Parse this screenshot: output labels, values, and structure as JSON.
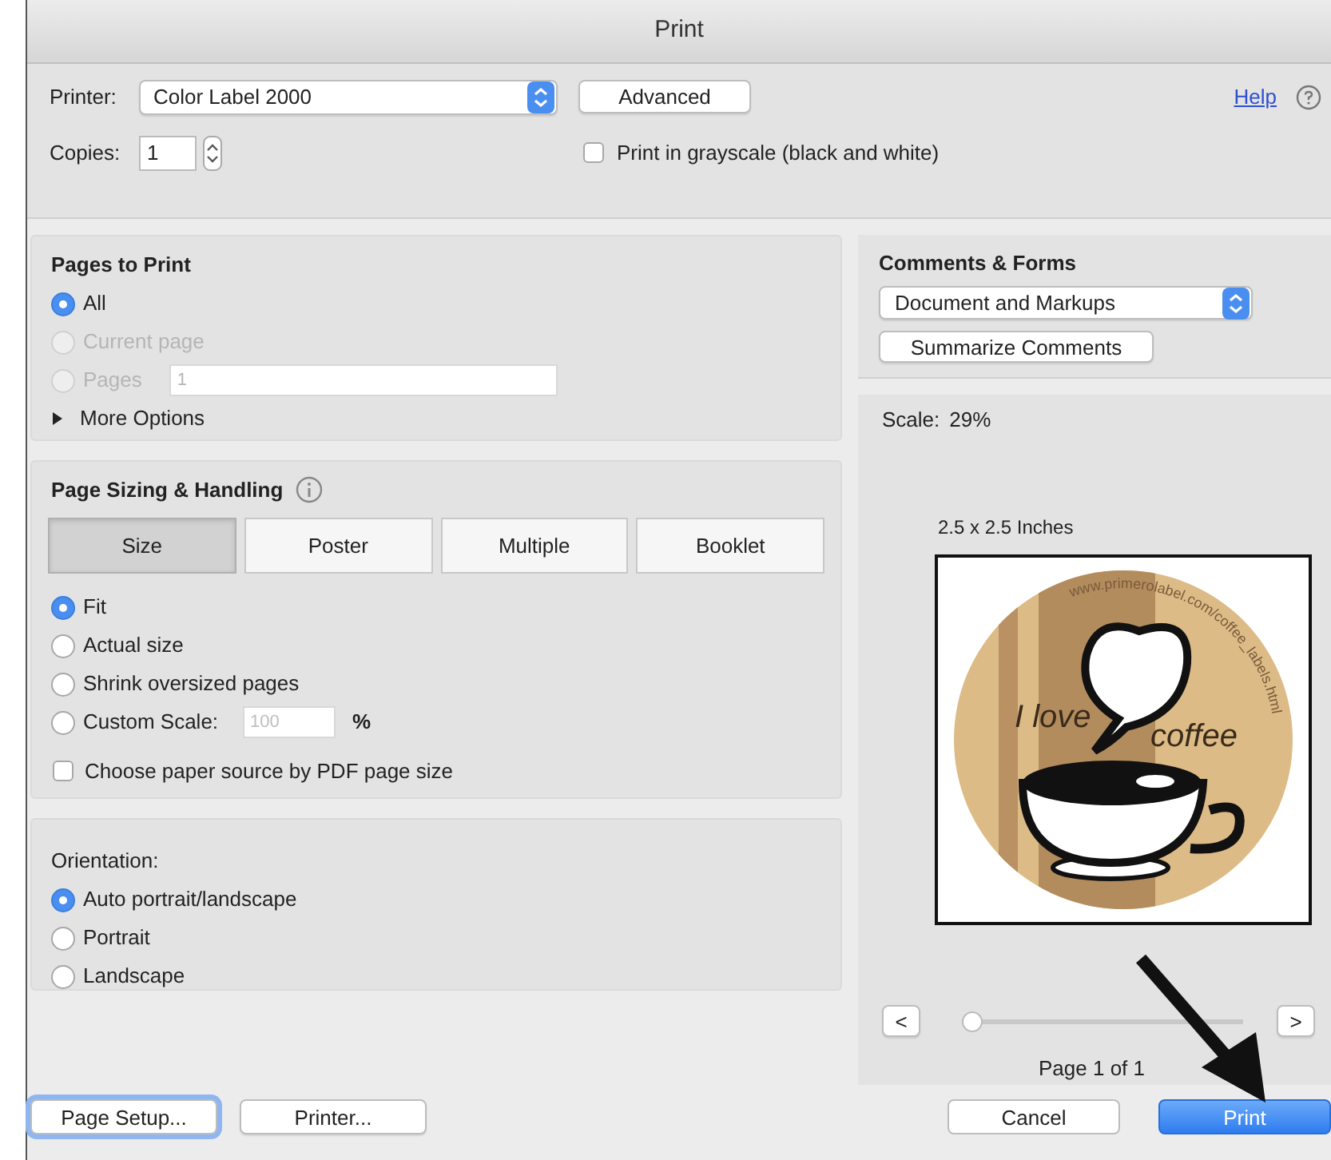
{
  "window": {
    "title": "Print"
  },
  "printer": {
    "label": "Printer:",
    "value": "Color Label 2000"
  },
  "advanced_button": "Advanced",
  "help_link": "Help",
  "copies": {
    "label": "Copies:",
    "value": "1"
  },
  "grayscale": {
    "label": "Print in grayscale (black and white)",
    "checked": false
  },
  "pages_to_print": {
    "title": "Pages to Print",
    "options": [
      {
        "label": "All",
        "selected": true,
        "disabled": false
      },
      {
        "label": "Current page",
        "selected": false,
        "disabled": true
      },
      {
        "label": "Pages",
        "selected": false,
        "disabled": true,
        "field_value": "1"
      }
    ],
    "more_options": {
      "label": "More Options",
      "expanded": false
    }
  },
  "page_sizing": {
    "title": "Page Sizing & Handling",
    "tabs": [
      {
        "label": "Size",
        "selected": true
      },
      {
        "label": "Poster",
        "selected": false
      },
      {
        "label": "Multiple",
        "selected": false
      },
      {
        "label": "Booklet",
        "selected": false
      }
    ],
    "options": [
      {
        "label": "Fit",
        "selected": true
      },
      {
        "label": "Actual size",
        "selected": false
      },
      {
        "label": "Shrink oversized pages",
        "selected": false
      },
      {
        "label": "Custom Scale:",
        "selected": false,
        "placeholder": "100",
        "unit": "%"
      }
    ],
    "paper_source": {
      "label": "Choose paper source by PDF page size",
      "checked": false
    }
  },
  "orientation": {
    "title": "Orientation:",
    "options": [
      {
        "label": "Auto portrait/landscape",
        "selected": true
      },
      {
        "label": "Portrait",
        "selected": false
      },
      {
        "label": "Landscape",
        "selected": false
      }
    ]
  },
  "comments_forms": {
    "title": "Comments & Forms",
    "value": "Document and Markups",
    "summarize_button": "Summarize Comments"
  },
  "preview": {
    "scale_label": "Scale:",
    "scale_value": "29%",
    "size": "2.5 x 2.5 Inches",
    "label_texts": [
      "I love",
      "coffee",
      "www.primerolabel.com/coffee_labels.html"
    ],
    "prev": "<",
    "next": ">",
    "slider": {
      "level": 0
    },
    "page": "Page 1 of 1"
  },
  "footer": {
    "left": [
      {
        "label": "Page Setup...",
        "focused": true
      },
      {
        "label": "Printer...",
        "focused": false
      }
    ],
    "right": [
      {
        "label": "Cancel",
        "default": false
      },
      {
        "label": "Print",
        "default": true
      }
    ]
  }
}
